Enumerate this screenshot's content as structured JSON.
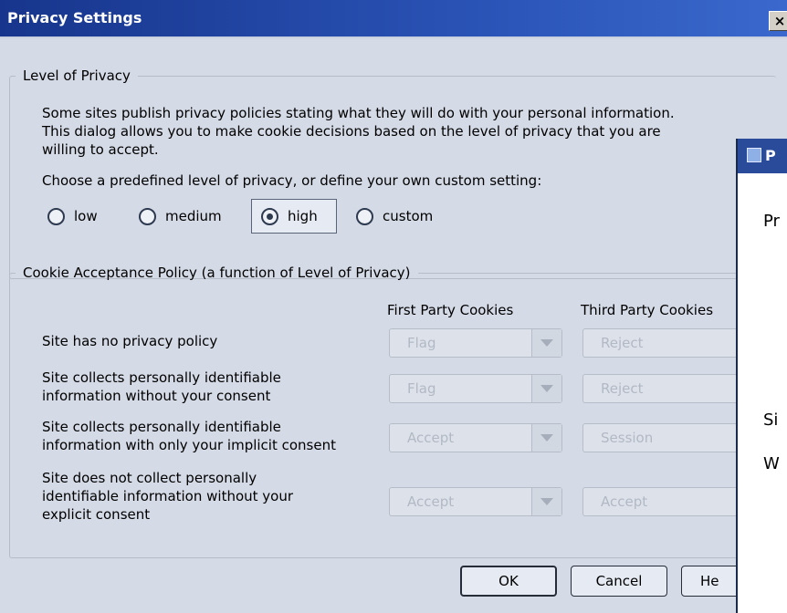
{
  "window": {
    "title": "Privacy Settings",
    "close_label": "×"
  },
  "privacy_group": {
    "legend": "Level of Privacy",
    "description_lines": [
      "Some sites publish privacy policies stating what they will do with your personal information.",
      "This dialog allows you to make cookie decisions based on the level of privacy that you are",
      "willing to accept."
    ],
    "prompt": "Choose a predefined level of privacy, or define your own custom setting:",
    "options": [
      {
        "label": "low",
        "checked": false
      },
      {
        "label": "medium",
        "checked": false
      },
      {
        "label": "high",
        "checked": true
      },
      {
        "label": "custom",
        "checked": false
      }
    ]
  },
  "cookie_group": {
    "legend": "Cookie Acceptance Policy (a function of Level of Privacy)",
    "col_first": "First Party Cookies",
    "col_third": "Third Party Cookies",
    "rows": [
      {
        "label_lines": [
          "Site has no privacy policy"
        ],
        "first": "Flag",
        "third": "Reject"
      },
      {
        "label_lines": [
          "Site collects personally identifiable",
          "information without your consent"
        ],
        "first": "Flag",
        "third": "Reject"
      },
      {
        "label_lines": [
          "Site collects personally identifiable",
          "information with only your implicit consent"
        ],
        "first": "Accept",
        "third": "Session"
      },
      {
        "label_lines": [
          "Site does not collect personally",
          "identifiable information without your",
          "explicit consent"
        ],
        "first": "Accept",
        "third": "Accept"
      }
    ]
  },
  "buttons": {
    "ok": "OK",
    "cancel": "Cancel",
    "help": "He"
  },
  "background_window": {
    "title_fragment": "P",
    "fragments": [
      "Pr",
      "Si",
      "W"
    ]
  }
}
